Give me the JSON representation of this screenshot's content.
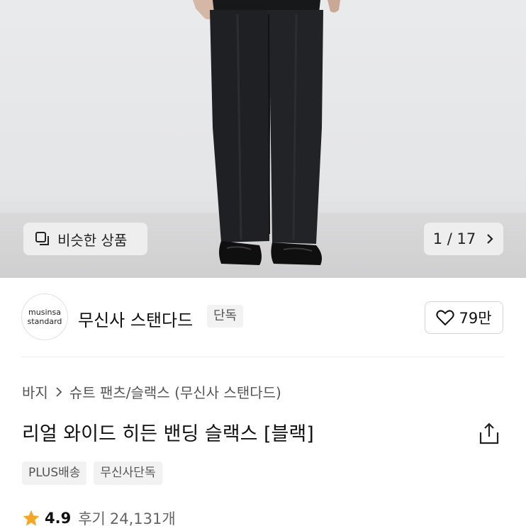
{
  "hero": {
    "similar_label": "비슷한 상품",
    "pager": "1 / 17"
  },
  "brand": {
    "logo_line1": "musinsa",
    "logo_line2": "standard",
    "name": "무신사 스탠다드",
    "badge": "단독",
    "likes": "79만"
  },
  "breadcrumb": {
    "level1": "바지",
    "level2": "슈트 팬츠/슬랙스 (무신사 스탠다드)"
  },
  "product": {
    "title": "리얼 와이드 히든 밴딩 슬랙스 [블랙]",
    "tags": [
      "PLUS배송",
      "무신사단독"
    ],
    "rating": "4.9",
    "review_label": "후기",
    "review_count": "24,131개"
  },
  "colors": {
    "star": "#f5a623",
    "pants": "#1c1d20",
    "background": "#e7e8ea"
  }
}
